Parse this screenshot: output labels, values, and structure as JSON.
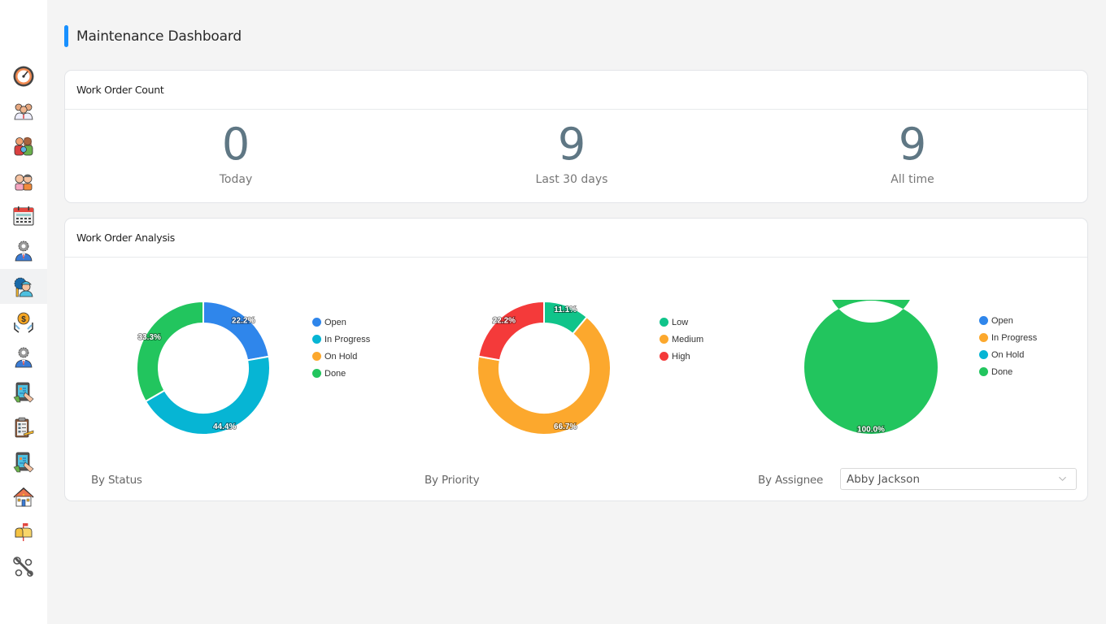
{
  "sidebar": {
    "items": [
      {
        "icon": "speedometer-icon",
        "label": "Dashboard"
      },
      {
        "icon": "team-icon",
        "label": "Team"
      },
      {
        "icon": "family-icon",
        "label": "Families"
      },
      {
        "icon": "couple-icon",
        "label": "Residents"
      },
      {
        "icon": "calendar-icon",
        "label": "Calendar"
      },
      {
        "icon": "manager-gear-icon",
        "label": "Management"
      },
      {
        "icon": "maintenance-worker-icon",
        "label": "Maintenance",
        "active": true
      },
      {
        "icon": "finance-hands-icon",
        "label": "Finance"
      },
      {
        "icon": "manager-gear-icon",
        "label": "Administration"
      },
      {
        "icon": "tablet-hand-icon",
        "label": "Tablet"
      },
      {
        "icon": "clipboard-icon",
        "label": "Checklist"
      },
      {
        "icon": "tablet-hand-icon",
        "label": "Devices"
      },
      {
        "icon": "house-icon",
        "label": "Properties"
      },
      {
        "icon": "mailbox-icon",
        "label": "Mailbox"
      },
      {
        "icon": "tools-icon",
        "label": "Settings"
      }
    ]
  },
  "header": {
    "title": "Maintenance Dashboard",
    "accent": "#1890ff"
  },
  "count_card": {
    "title": "Work Order Count",
    "stats": [
      {
        "value": "0",
        "label": "Today"
      },
      {
        "value": "9",
        "label": "Last 30 days"
      },
      {
        "value": "9",
        "label": "All time"
      }
    ]
  },
  "analysis_card": {
    "title": "Work Order Analysis",
    "by_status_label": "By Status",
    "by_priority_label": "By Priority",
    "by_assignee_label": "By Assignee",
    "assignee_select": {
      "value": "Abby Jackson"
    }
  },
  "chart_data": [
    {
      "type": "pie",
      "donut": true,
      "title": "By Status",
      "categories": [
        "Open",
        "In Progress",
        "On Hold",
        "Done"
      ],
      "values": [
        22.2,
        44.4,
        0,
        33.3
      ],
      "labels": [
        "22.2%",
        "44.4%",
        "",
        "33.3%"
      ],
      "colors": [
        "#2f86eb",
        "#06b5d4",
        "#fca82d",
        "#22c55e"
      ],
      "legend": "right"
    },
    {
      "type": "pie",
      "donut": true,
      "title": "By Priority",
      "categories": [
        "Low",
        "Medium",
        "High"
      ],
      "values": [
        11.1,
        66.7,
        22.2
      ],
      "labels": [
        "11.1%",
        "66.7%",
        "22.2%"
      ],
      "colors": [
        "#10c48a",
        "#fca82d",
        "#f43a3a"
      ],
      "legend": "right"
    },
    {
      "type": "pie",
      "donut": true,
      "title": "By Assignee",
      "categories": [
        "Open",
        "In Progress",
        "On Hold",
        "Done"
      ],
      "values": [
        0,
        0,
        0,
        100.0
      ],
      "labels": [
        "",
        "",
        "",
        "100.0%"
      ],
      "colors": [
        "#2f86eb",
        "#fca82d",
        "#06b5d4",
        "#22c55e"
      ],
      "legend": "right"
    }
  ]
}
